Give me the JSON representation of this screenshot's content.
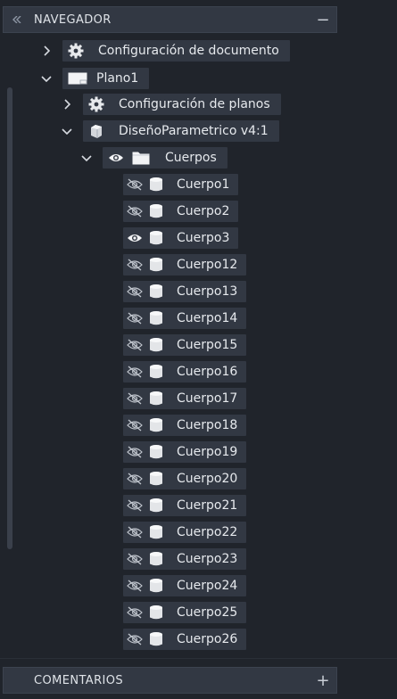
{
  "navigator": {
    "title": "NAVEGADOR",
    "collapse_icon": "double-chevron-left-icon",
    "minimize_glyph": "−"
  },
  "tree": {
    "doc_settings": "Configuración de documento",
    "plano": "Plano1",
    "sheet_settings": "Configuración de planos",
    "model": "DiseñoParametrico v4:1",
    "bodies_folder": "Cuerpos",
    "bodies": [
      {
        "name": "Cuerpo1",
        "visible": false
      },
      {
        "name": "Cuerpo2",
        "visible": false
      },
      {
        "name": "Cuerpo3",
        "visible": true
      },
      {
        "name": "Cuerpo12",
        "visible": false
      },
      {
        "name": "Cuerpo13",
        "visible": false
      },
      {
        "name": "Cuerpo14",
        "visible": false
      },
      {
        "name": "Cuerpo15",
        "visible": false
      },
      {
        "name": "Cuerpo16",
        "visible": false
      },
      {
        "name": "Cuerpo17",
        "visible": false
      },
      {
        "name": "Cuerpo18",
        "visible": false
      },
      {
        "name": "Cuerpo19",
        "visible": false
      },
      {
        "name": "Cuerpo20",
        "visible": false
      },
      {
        "name": "Cuerpo21",
        "visible": false
      },
      {
        "name": "Cuerpo22",
        "visible": false
      },
      {
        "name": "Cuerpo23",
        "visible": false
      },
      {
        "name": "Cuerpo24",
        "visible": false
      },
      {
        "name": "Cuerpo25",
        "visible": false
      },
      {
        "name": "Cuerpo26",
        "visible": false
      }
    ]
  },
  "comments": {
    "title": "COMENTARIOS",
    "plus_glyph": "+"
  },
  "colors": {
    "background": "#20242b",
    "node_bg": "#323843",
    "text": "#e6e9ed"
  }
}
